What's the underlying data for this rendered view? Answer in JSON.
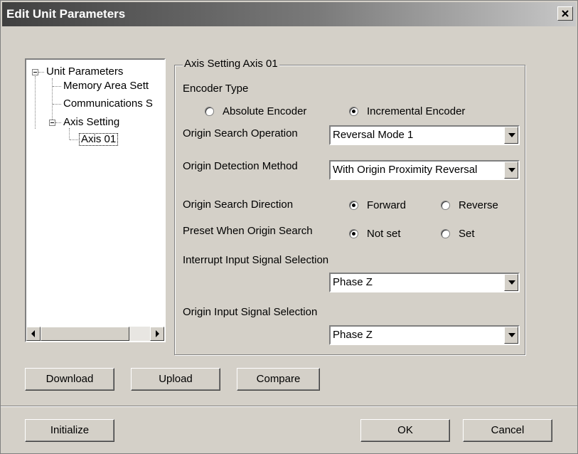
{
  "window": {
    "title": "Edit Unit Parameters",
    "close_icon": "close-icon"
  },
  "tree": {
    "root": "Unit Parameters",
    "memory": "Memory Area Sett",
    "communications": "Communications S",
    "axis_setting": "Axis Setting",
    "axis01": "Axis 01"
  },
  "group": {
    "legend": "Axis Setting Axis 01"
  },
  "encoder": {
    "label": "Encoder Type",
    "absolute": "Absolute Encoder",
    "incremental": "Incremental Encoder",
    "selected": "Incremental Encoder"
  },
  "origin_search_operation": {
    "label": "Origin Search Operation",
    "value": "Reversal Mode 1"
  },
  "origin_detection_method": {
    "label": "Origin Detection Method",
    "value": "With Origin Proximity Reversal"
  },
  "origin_search_direction": {
    "label": "Origin Search Direction",
    "forward": "Forward",
    "reverse": "Reverse",
    "selected": "Forward"
  },
  "preset": {
    "label": "Preset When Origin Search",
    "not_set": "Not set",
    "set": "Set",
    "selected": "Not set"
  },
  "interrupt": {
    "label": "Interrupt Input Signal Selection",
    "value": "Phase Z"
  },
  "origin_input": {
    "label": "Origin Input Signal Selection",
    "value": "Phase Z"
  },
  "buttons": {
    "download": "Download",
    "upload": "Upload",
    "compare": "Compare",
    "initialize": "Initialize",
    "ok": "OK",
    "cancel": "Cancel"
  }
}
